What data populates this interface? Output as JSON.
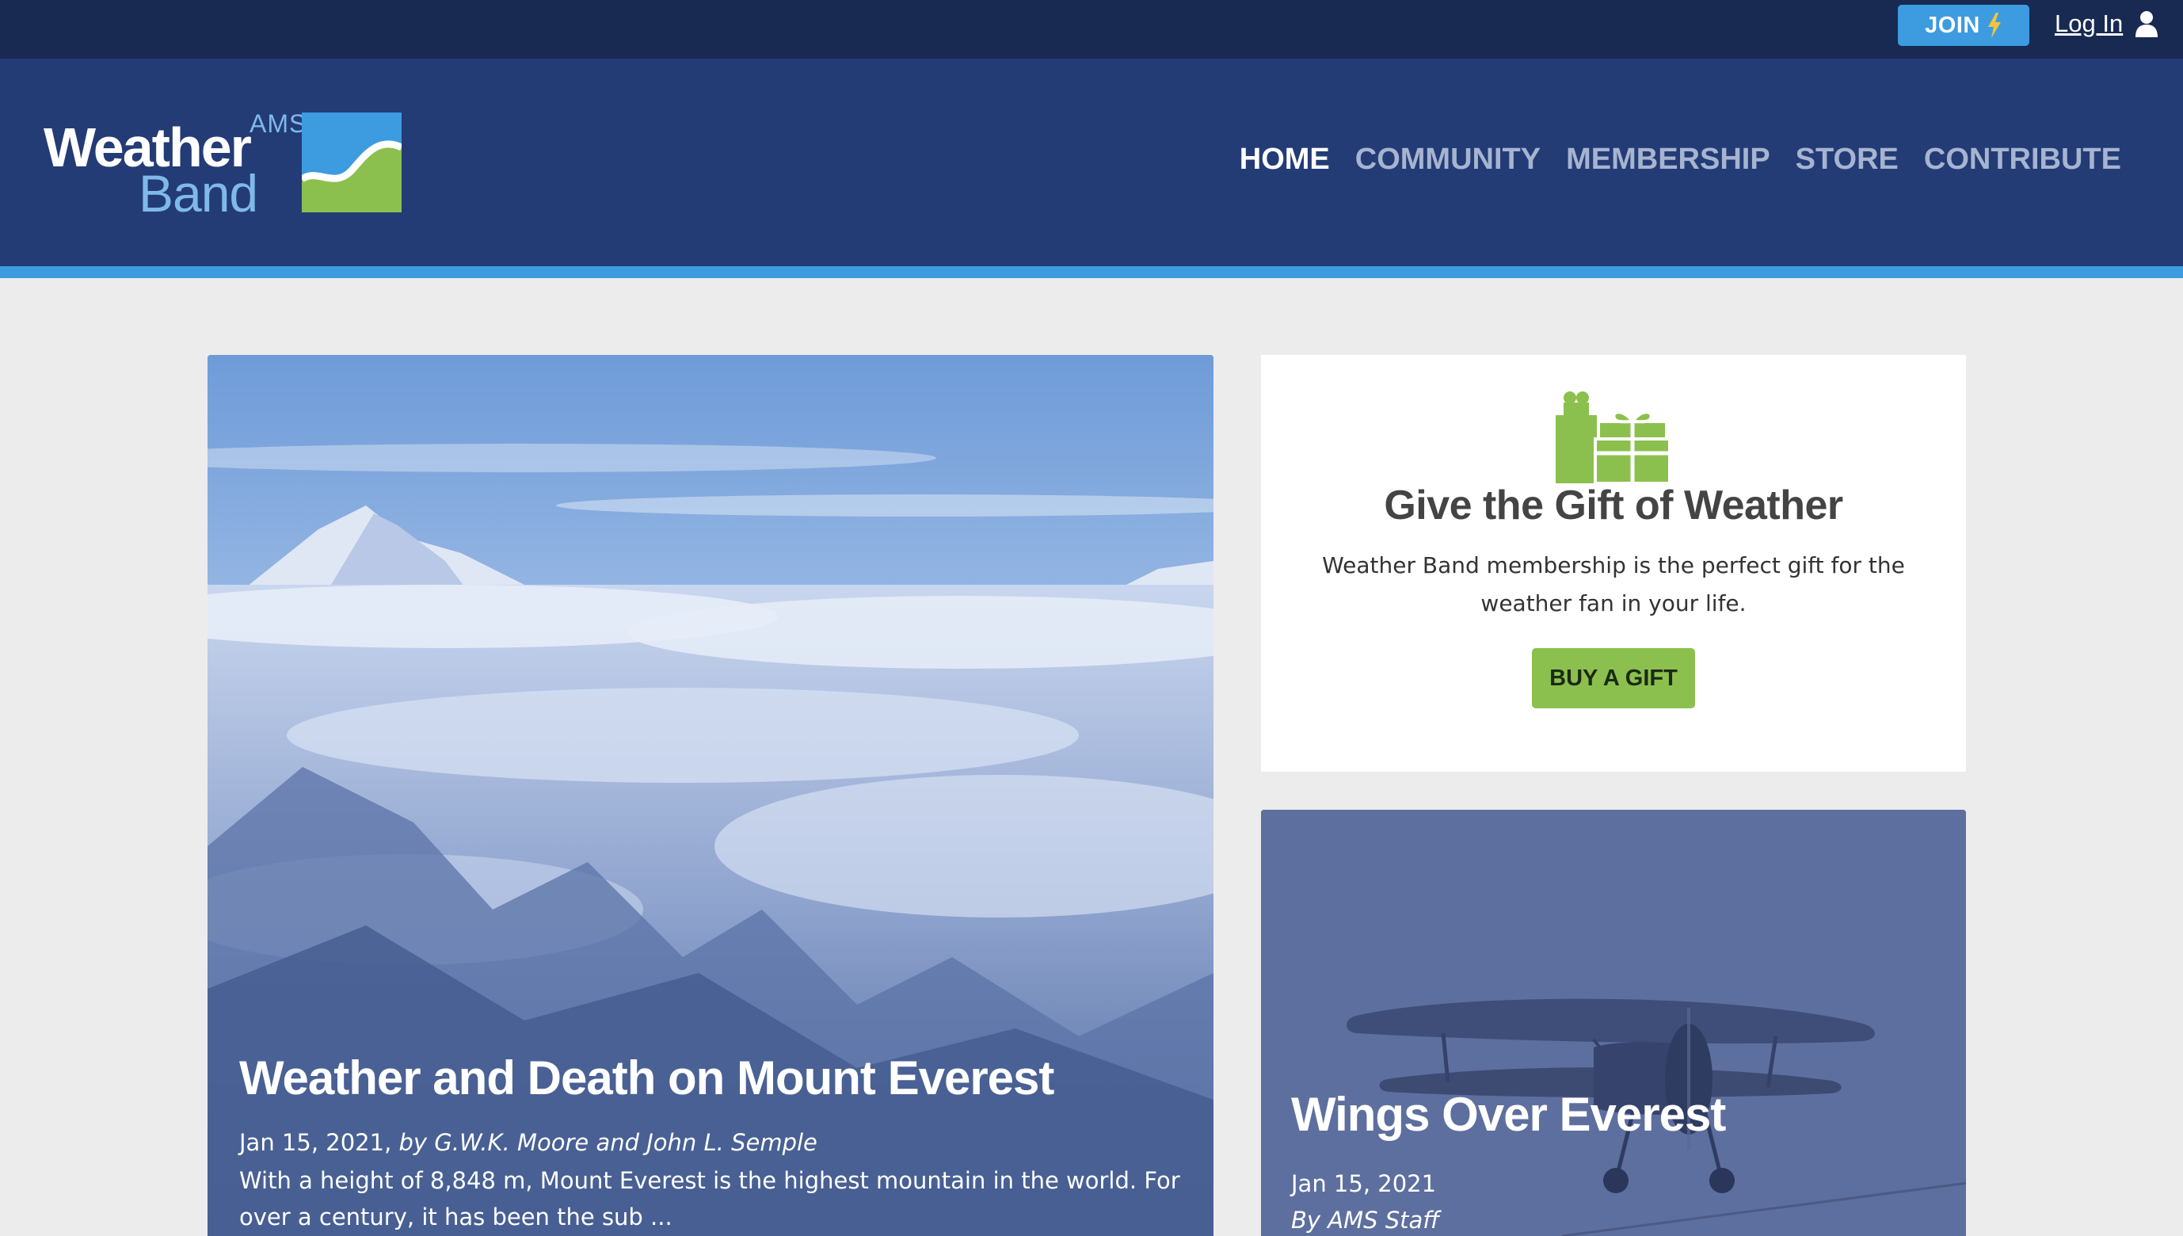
{
  "topbar": {
    "join_label": "JOIN",
    "login_label": "Log In"
  },
  "brand": {
    "ams": "AMS",
    "weather": "Weather",
    "band": "Band"
  },
  "nav": {
    "items": [
      {
        "label": "HOME",
        "active": true
      },
      {
        "label": "COMMUNITY",
        "active": false
      },
      {
        "label": "MEMBERSHIP",
        "active": false
      },
      {
        "label": "STORE",
        "active": false
      },
      {
        "label": "CONTRIBUTE",
        "active": false
      }
    ]
  },
  "hero": {
    "title": "Weather and Death on Mount Everest",
    "date": "Jan 15, 2021,",
    "byline": "by G.W.K. Moore and John L. Semple",
    "excerpt": "With a height of 8,848 m, Mount Everest is the highest mountain in the world. For over a century, it has been the sub ..."
  },
  "gift": {
    "icon": "gift-icon",
    "title": "Give the Gift of Weather",
    "description": "Weather Band membership is the perfect gift for the weather fan in your life.",
    "button_label": "BUY A GIFT"
  },
  "card2": {
    "title": "Wings Over Everest",
    "date": "Jan 15, 2021",
    "byline": "By AMS Staff"
  },
  "colors": {
    "topbar": "#182a52",
    "header": "#233c76",
    "accent_blue": "#3d9be0",
    "accent_green": "#8cc04e"
  }
}
